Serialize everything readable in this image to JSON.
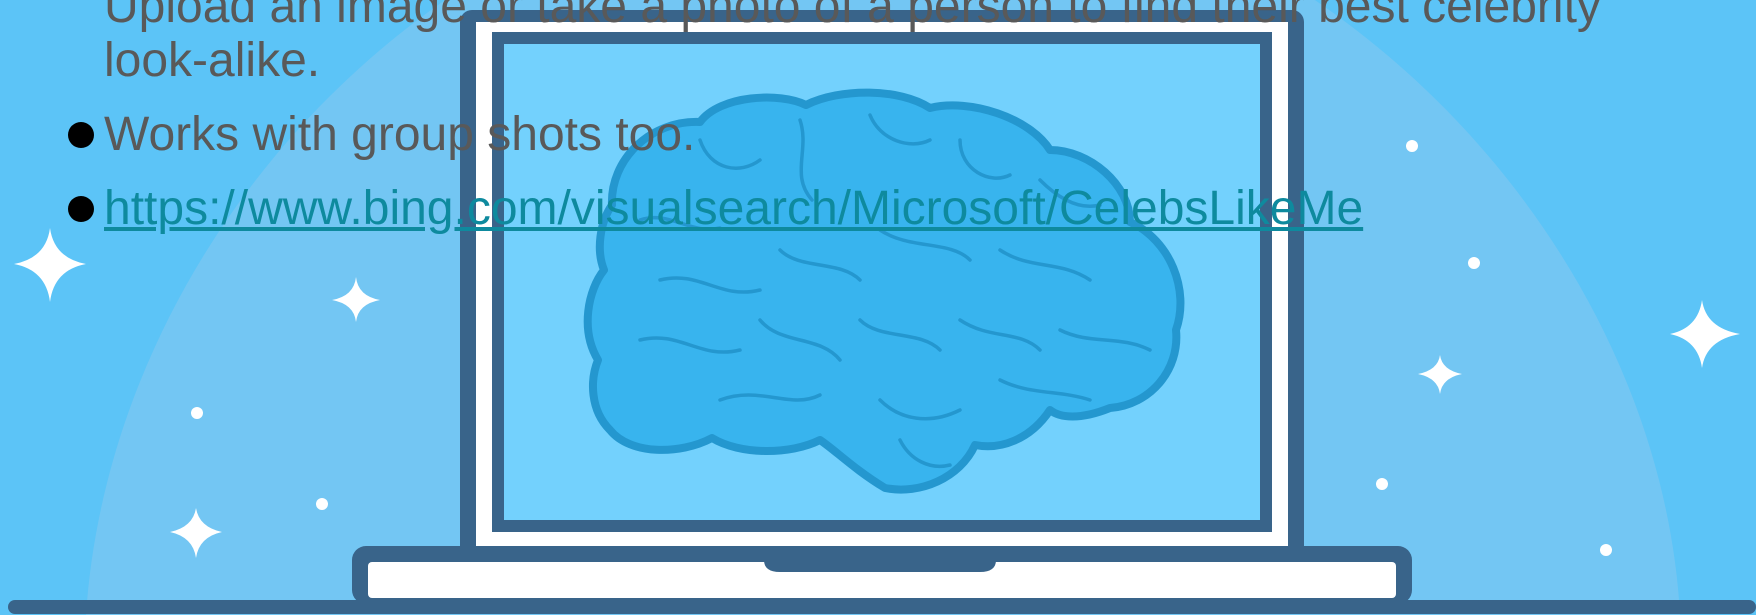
{
  "slide": {
    "bullets": [
      {
        "text": "Upload an image or take a photo of a person to find their best celebrity look-alike."
      },
      {
        "text": "Works with group shots too."
      }
    ],
    "link": {
      "text": "https://www.bing.com/visualsearch/Microsoft/CelebsLikeMe"
    }
  },
  "colors": {
    "background": "#5cc4f7",
    "dome": "#73c6f3",
    "laptop_frame": "#39648a",
    "screen": "#73d1fd",
    "brain_fill": "#38b4ee",
    "brain_outline": "#2497cf",
    "text": "#595959",
    "link": "#0e8a9e"
  },
  "illustration": {
    "icons": [
      "brain-icon",
      "laptop-icon",
      "sparkle-icon"
    ]
  }
}
